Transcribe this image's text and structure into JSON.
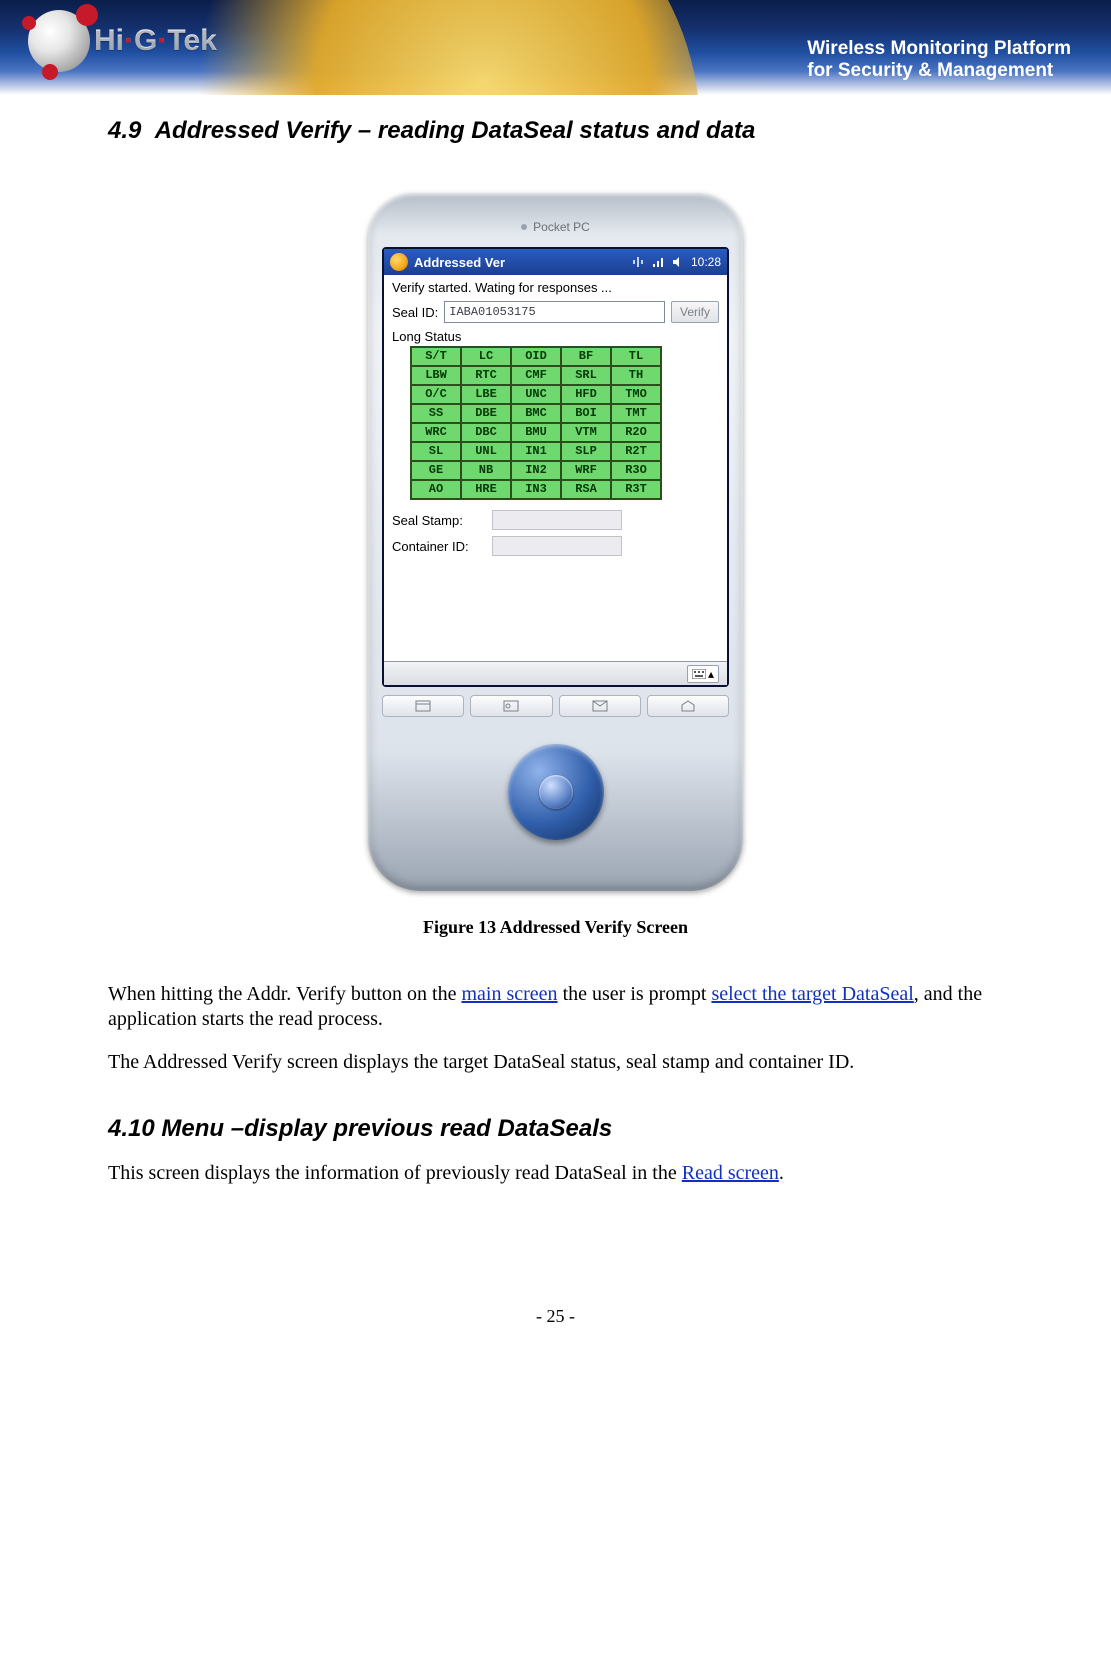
{
  "header": {
    "brand": "Hi·G·Tek",
    "tagline_line1": "Wireless Monitoring Platform",
    "tagline_line2": "for Security & Management"
  },
  "section1": {
    "number": "4.9",
    "title": "Addressed Verify – reading DataSeal status and data"
  },
  "device": {
    "top_label": "Pocket PC",
    "window_title": "Addressed Ver",
    "clock": "10:28",
    "status_line": "Verify started. Wating for responses ...",
    "seal_id_label": "Seal ID:",
    "seal_id_value": "IABA01053175",
    "verify_button": "Verify",
    "long_status_label": "Long Status",
    "grid": [
      [
        "S/T",
        "LC",
        "OID",
        "BF",
        "TL"
      ],
      [
        "LBW",
        "RTC",
        "CMF",
        "SRL",
        "TH"
      ],
      [
        "O/C",
        "LBE",
        "UNC",
        "HFD",
        "TMO"
      ],
      [
        "SS",
        "DBE",
        "BMC",
        "BOI",
        "TMT"
      ],
      [
        "WRC",
        "DBC",
        "BMU",
        "VTM",
        "R2O"
      ],
      [
        "SL",
        "UNL",
        "IN1",
        "SLP",
        "R2T"
      ],
      [
        "GE",
        "NB",
        "IN2",
        "WRF",
        "R3O"
      ],
      [
        "AO",
        "HRE",
        "IN3",
        "RSA",
        "R3T"
      ]
    ],
    "seal_stamp_label": "Seal Stamp:",
    "container_id_label": "Container ID:"
  },
  "figure_caption": "Figure 13 Addressed Verify Screen",
  "para1_parts": {
    "a": "When hitting the Addr. Verify button on the ",
    "link1": "main screen",
    "b": " the user is prompt ",
    "link2": "select the target DataSeal",
    "c": ", and the application starts the read process."
  },
  "para2": "The Addressed Verify screen displays the target DataSeal status, seal stamp and container ID.",
  "section2": {
    "number": "4.10",
    "title": "Menu –display previous read DataSeals"
  },
  "para3_parts": {
    "a": "This screen displays the information of previously read DataSeal in the ",
    "link1": "Read screen",
    "b": "."
  },
  "page_number": "- 25 -"
}
